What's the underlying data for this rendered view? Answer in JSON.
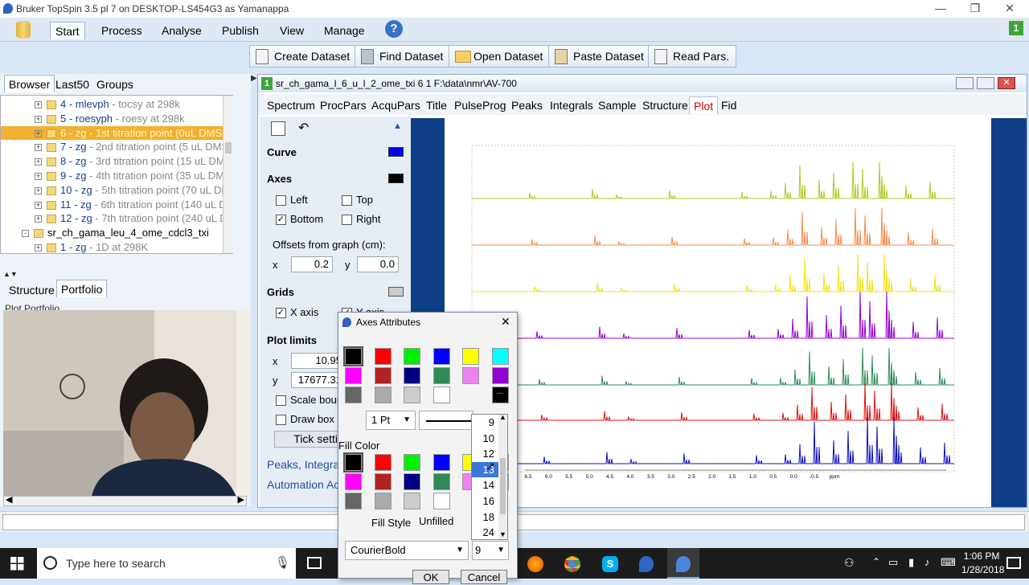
{
  "window": {
    "title": "Bruker TopSpin 3.5 pl 7 on DESKTOP-LS454G3 as Yamanappa",
    "min": "—",
    "max": "❐",
    "close": "✕"
  },
  "menu": {
    "items": [
      "Start",
      "Process",
      "Analyse",
      "Publish",
      "View",
      "Manage"
    ],
    "help": "?",
    "badge": "1"
  },
  "toolbar": {
    "buttons": [
      "Create Dataset",
      "Find Dataset",
      "Open Dataset",
      "Paste Dataset",
      "Read Pars."
    ]
  },
  "browser": {
    "tabs": [
      "Browser",
      "Last50",
      "Groups"
    ],
    "rows": [
      {
        "num": "4 - mlevph",
        "desc": "- tocsy at 298k"
      },
      {
        "num": "5 - roesyph",
        "desc": "- roesy at 298k"
      },
      {
        "num": "6 - zg",
        "desc": "- 1st titration point (0uL DMSO"
      },
      {
        "num": "7 - zg",
        "desc": "- 2nd titration point (5 uL DMS"
      },
      {
        "num": "8 - zg",
        "desc": "- 3rd titration point (15 uL DM"
      },
      {
        "num": "9 - zg",
        "desc": "- 4th titration point (35 uL DM"
      },
      {
        "num": "10 - zg",
        "desc": "- 5th titration point (70 uL DM"
      },
      {
        "num": "11 - zg",
        "desc": "- 6th titration point (140 uL D"
      },
      {
        "num": "12 - zg",
        "desc": "- 7th titration point (240 uL D"
      },
      {
        "num": "sr_ch_gama_leu_4_ome_cdcl3_txi",
        "desc": ""
      },
      {
        "num": "1 - zg",
        "desc": "- 1D at 298K"
      }
    ],
    "lower_tabs": [
      "Structure",
      "Portfolio"
    ],
    "portfolio_label": "Plot Portfolio"
  },
  "dataset": {
    "badge": "1",
    "title": "sr_ch_gama_l_6_u_l_2_ome_txi  6  1  F:\\data\\nmr\\AV-700",
    "tabs": [
      "Spectrum",
      "ProcPars",
      "AcquPars",
      "Title",
      "PulseProg",
      "Peaks",
      "Integrals",
      "Sample",
      "Structure",
      "Plot",
      "Fid"
    ]
  },
  "plot_panel": {
    "curve": "Curve",
    "axes": "Axes",
    "left": "Left",
    "top": "Top",
    "bottom": "Bottom",
    "right": "Right",
    "offsets_label": "Offsets from graph (cm):",
    "x": "x",
    "y": "y",
    "x_val": "0.2",
    "y_val": "0.0",
    "grids": "Grids",
    "x_axis": "X axis",
    "y_axis": "Y axis",
    "plot_limits": "Plot limits",
    "px_val": "10.95",
    "py_val": "17677.31",
    "scale_bound": "Scale bour",
    "draw_box": "Draw box a",
    "tick_settings": "Tick setti",
    "link1": "Peaks, Integral",
    "link2": "Automation Act"
  },
  "spectrum_axis": [
    "6.5",
    "6.0",
    "5.5",
    "5.0",
    "4.5",
    "4.0",
    "3.5",
    "3.0",
    "2.5",
    "2.0",
    "1.5",
    "1.0",
    "0.5",
    "0.0",
    "-0.5",
    "ppm"
  ],
  "dialog": {
    "title": "Axes Attributes",
    "close": "✕",
    "line_width": "1 Pt",
    "fill_color": "Fill Color",
    "fill_style_label": "Fill Style",
    "fill_style": "Unfilled",
    "font": "CourierBold",
    "font_size": "9",
    "ok": "OK",
    "cancel": "Cancel",
    "size_options": [
      "9",
      "10",
      "12",
      "13",
      "14",
      "16",
      "18",
      "24"
    ],
    "selected_size": "13"
  },
  "taskbar": {
    "search_placeholder": "Type here to search",
    "time": "1:06 PM",
    "date": "1/28/2018"
  },
  "colors": {
    "accent": "#1f4ea8",
    "highlight": "#f2b132",
    "canvas_border": "#0e3f86"
  }
}
